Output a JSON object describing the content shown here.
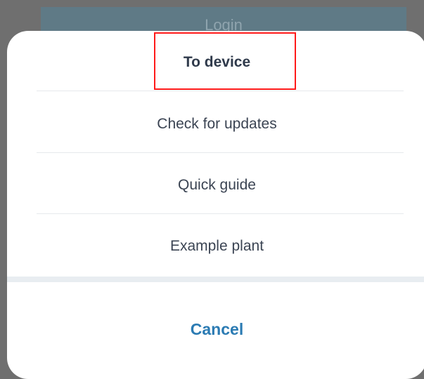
{
  "background": {
    "login_label": "Login"
  },
  "menu": {
    "items": [
      {
        "label": "To device"
      },
      {
        "label": "Check for updates"
      },
      {
        "label": "Quick guide"
      },
      {
        "label": "Example plant"
      }
    ],
    "cancel_label": "Cancel"
  },
  "colors": {
    "accent": "#2b7bb3",
    "highlight": "#ff1a1a"
  }
}
